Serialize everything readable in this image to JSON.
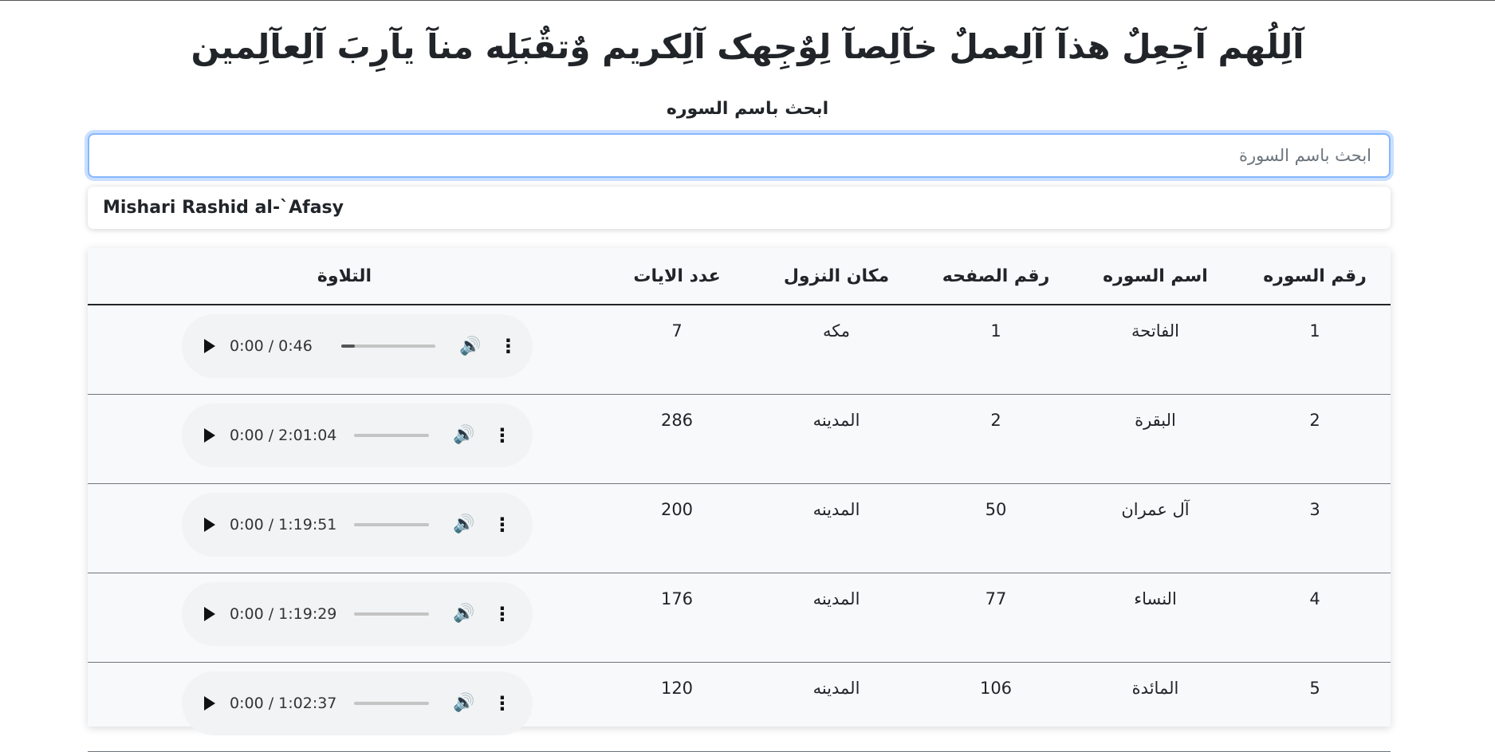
{
  "page": {
    "title": "آلِلُهم آجِعِلٌ هذآ آلِعملٌ خآلِصآ لِوٌجِهک آلِکريم وٌتقٌبَلِه منآ يآرِبَ آلِعآلِمين",
    "search_label": "ابحث باسم السوره",
    "search_placeholder": "ابحث باسم السورة",
    "search_value": "",
    "reciter": "Mishari Rashid al-`Afasy"
  },
  "table": {
    "headers": {
      "number": "رقم السوره",
      "name": "اسم السوره",
      "page": "رقم الصفحه",
      "place": "مكان النزول",
      "ayahs": "عدد الايات",
      "recitation": "التلاوة"
    },
    "rows": [
      {
        "number": "1",
        "name": "الفاتحة",
        "page": "1",
        "place": "مكه",
        "ayahs": "7",
        "time": "0:00 / 0:46",
        "progress": 0.14
      },
      {
        "number": "2",
        "name": "البقرة",
        "page": "2",
        "place": "المدينه",
        "ayahs": "286",
        "time": "0:00 / 2:01:04",
        "progress": 0
      },
      {
        "number": "3",
        "name": "آل عمران",
        "page": "50",
        "place": "المدينه",
        "ayahs": "200",
        "time": "0:00 / 1:19:51",
        "progress": 0
      },
      {
        "number": "4",
        "name": "النساء",
        "page": "77",
        "place": "المدينه",
        "ayahs": "176",
        "time": "0:00 / 1:19:29",
        "progress": 0
      },
      {
        "number": "5",
        "name": "المائدة",
        "page": "106",
        "place": "المدينه",
        "ayahs": "120",
        "time": "0:00 / 1:02:37",
        "progress": 0
      }
    ]
  },
  "icons": {
    "play": "play-icon",
    "volume": "volume-icon",
    "more": "more-vertical-icon"
  },
  "colors": {
    "focus_border": "#86b7fe",
    "table_bg": "#f8f9fa",
    "player_bg": "#f1f3f4"
  }
}
